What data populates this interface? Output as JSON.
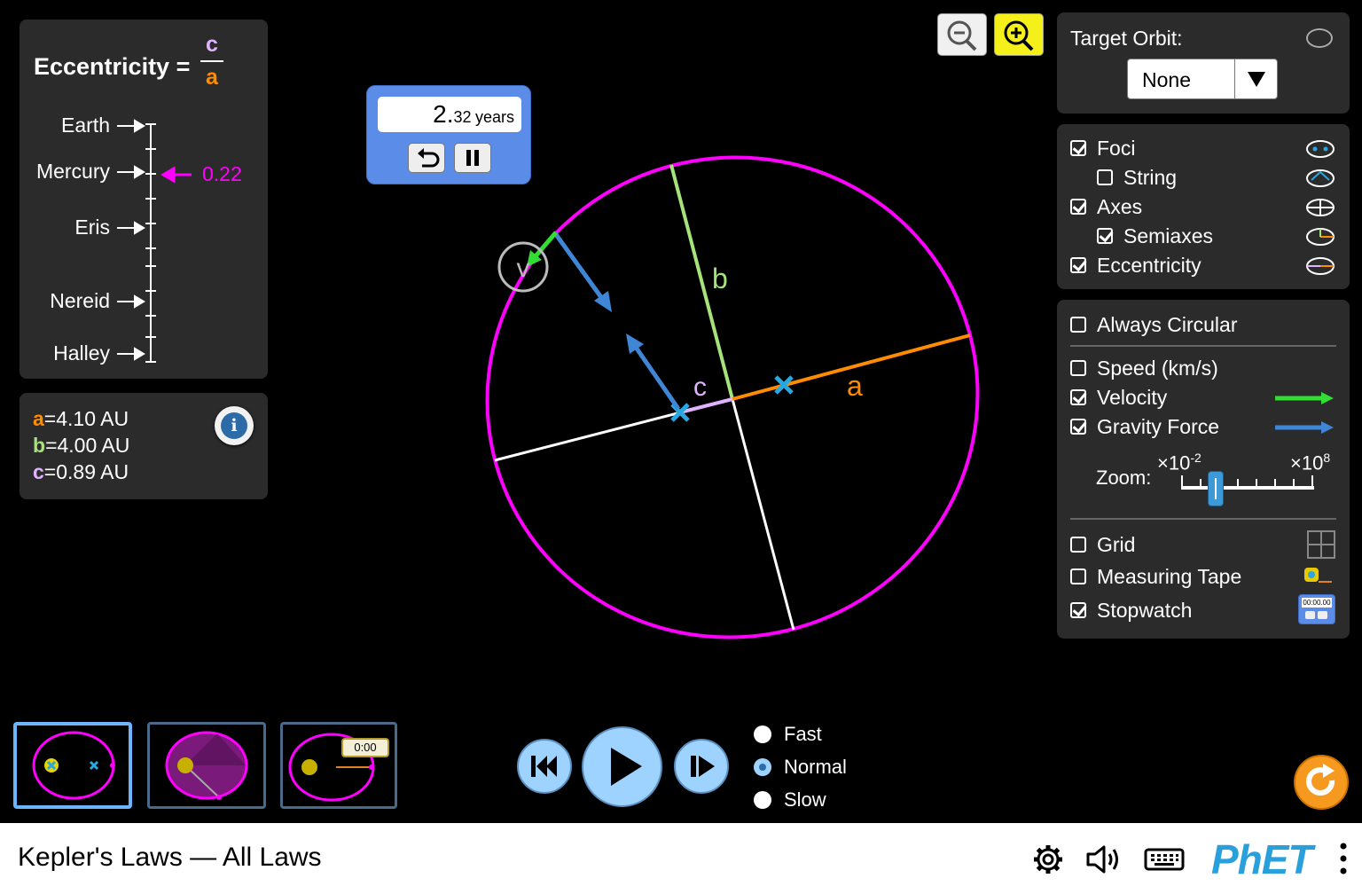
{
  "eccentricity_panel": {
    "title": "Eccentricity",
    "equals": "=",
    "numerator": "c",
    "denominator": "a",
    "markers": [
      "Earth",
      "Mercury",
      "Eris",
      "Nereid",
      "Halley"
    ],
    "current_value": "0.22"
  },
  "values_panel": {
    "a_label": "a",
    "a_value": "=4.10 AU",
    "b_label": "b",
    "b_value": "=4.00 AU",
    "c_label": "c",
    "c_value": "=0.89 AU"
  },
  "stopwatch": {
    "value_big": "2.",
    "value_small": "32",
    "unit": "years"
  },
  "orbit_labels": {
    "a": "a",
    "b": "b",
    "c": "c",
    "v": "v"
  },
  "target_orbit": {
    "label": "Target Orbit:",
    "selected": "None"
  },
  "options_1": {
    "foci": "Foci",
    "string": "String",
    "axes": "Axes",
    "semiaxes": "Semiaxes",
    "eccentricity": "Eccentricity"
  },
  "options_2": {
    "always_circular": "Always Circular",
    "speed": "Speed (km/s)",
    "velocity": "Velocity",
    "gravity_force": "Gravity Force",
    "zoom_label": "Zoom:",
    "zoom_min": "×10",
    "zoom_min_exp": "-2",
    "zoom_max": "×10",
    "zoom_max_exp": "8",
    "grid": "Grid",
    "measuring_tape": "Measuring Tape",
    "stopwatch": "Stopwatch",
    "stopwatch_icon_text": "00:00.00"
  },
  "screen_thumb_timer": "0:00",
  "speed_options": {
    "fast": "Fast",
    "normal": "Normal",
    "slow": "Slow",
    "selected": "Normal"
  },
  "footer": {
    "title": "Kepler's Laws — All Laws",
    "brand": "PhET"
  },
  "colors": {
    "orbit": "#ff00ff",
    "a_axis": "#ff8c00",
    "b_axis": "#a6e37a",
    "c_axis": "#e0b3ff",
    "velocity": "#33dd33",
    "gravity": "#3f86d6",
    "focus": "#2aa7e0"
  }
}
